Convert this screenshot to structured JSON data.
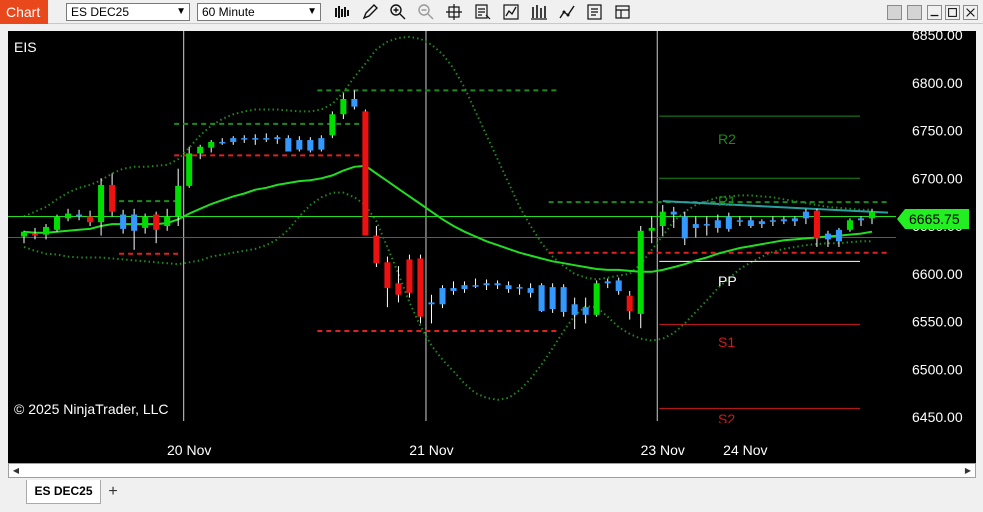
{
  "titlebar": {
    "chart_button": "Chart",
    "instrument": "ES DEC25",
    "interval": "60 Minute"
  },
  "toolbar_icons": [
    "bar-style-icon",
    "pencil-draw-icon",
    "zoom-in-icon",
    "zoom-out-icon",
    "crosshair-icon",
    "data-box-icon",
    "indicators-icon",
    "strategies-icon",
    "drawing-tools-icon",
    "properties-icon"
  ],
  "chart": {
    "symbol_label": "EIS",
    "copyright": "© 2025 NinjaTrader, LLC",
    "current_price": "6665.75",
    "pivot_labels": {
      "r2": "R2",
      "r1": "R1",
      "pp": "PP",
      "s1": "S1",
      "s2": "S2"
    },
    "colors": {
      "up": "#00dd00",
      "down": "#ee1111",
      "neutral_up": "#3399ff",
      "ma": "#22dd22",
      "bands": "#1f8a1f",
      "price_tag": "#22ee22"
    }
  },
  "chart_data": {
    "type": "candlestick",
    "y_axis": {
      "min": 6450,
      "max": 6850,
      "ticks": [
        "6850.00",
        "6800.00",
        "6750.00",
        "6700.00",
        "6650.00",
        "6600.00",
        "6550.00",
        "6500.00",
        "6450.00"
      ]
    },
    "x_ticks": [
      "20 Nov",
      "21 Nov",
      "23 Nov",
      "24 Nov"
    ],
    "candles": [
      {
        "o": 6639,
        "h": 6645,
        "l": 6632,
        "c": 6644,
        "t": "u"
      },
      {
        "o": 6642,
        "h": 6648,
        "l": 6636,
        "c": 6640,
        "t": "d"
      },
      {
        "o": 6641,
        "h": 6652,
        "l": 6636,
        "c": 6649,
        "t": "u"
      },
      {
        "o": 6646,
        "h": 6662,
        "l": 6644,
        "c": 6660,
        "t": "u"
      },
      {
        "o": 6658,
        "h": 6668,
        "l": 6655,
        "c": 6663,
        "t": "u"
      },
      {
        "o": 6662,
        "h": 6667,
        "l": 6656,
        "c": 6660,
        "t": "n"
      },
      {
        "o": 6660,
        "h": 6666,
        "l": 6650,
        "c": 6654,
        "t": "d"
      },
      {
        "o": 6654,
        "h": 6700,
        "l": 6640,
        "c": 6693,
        "t": "u"
      },
      {
        "o": 6693,
        "h": 6705,
        "l": 6660,
        "c": 6665,
        "t": "d"
      },
      {
        "o": 6662,
        "h": 6667,
        "l": 6642,
        "c": 6647,
        "t": "n"
      },
      {
        "o": 6662,
        "h": 6668,
        "l": 6625,
        "c": 6645,
        "t": "n"
      },
      {
        "o": 6648,
        "h": 6663,
        "l": 6642,
        "c": 6660,
        "t": "u"
      },
      {
        "o": 6662,
        "h": 6665,
        "l": 6632,
        "c": 6646,
        "t": "d"
      },
      {
        "o": 6650,
        "h": 6668,
        "l": 6645,
        "c": 6660,
        "t": "u"
      },
      {
        "o": 6660,
        "h": 6710,
        "l": 6650,
        "c": 6692,
        "t": "u"
      },
      {
        "o": 6692,
        "h": 6733,
        "l": 6690,
        "c": 6726,
        "t": "u"
      },
      {
        "o": 6726,
        "h": 6735,
        "l": 6720,
        "c": 6733,
        "t": "u"
      },
      {
        "o": 6732,
        "h": 6740,
        "l": 6727,
        "c": 6738,
        "t": "u"
      },
      {
        "o": 6738,
        "h": 6742,
        "l": 6735,
        "c": 6737,
        "t": "n"
      },
      {
        "o": 6738,
        "h": 6744,
        "l": 6735,
        "c": 6742,
        "t": "n"
      },
      {
        "o": 6742,
        "h": 6745,
        "l": 6737,
        "c": 6741,
        "t": "n"
      },
      {
        "o": 6741,
        "h": 6746,
        "l": 6735,
        "c": 6742,
        "t": "n"
      },
      {
        "o": 6742,
        "h": 6747,
        "l": 6738,
        "c": 6741,
        "t": "n"
      },
      {
        "o": 6741,
        "h": 6745,
        "l": 6736,
        "c": 6743,
        "t": "n"
      },
      {
        "o": 6742,
        "h": 6745,
        "l": 6729,
        "c": 6728,
        "t": "n"
      },
      {
        "o": 6740,
        "h": 6744,
        "l": 6728,
        "c": 6730,
        "t": "n"
      },
      {
        "o": 6740,
        "h": 6743,
        "l": 6727,
        "c": 6729,
        "t": "n"
      },
      {
        "o": 6730,
        "h": 6745,
        "l": 6728,
        "c": 6742,
        "t": "n"
      },
      {
        "o": 6745,
        "h": 6770,
        "l": 6742,
        "c": 6767,
        "t": "u"
      },
      {
        "o": 6767,
        "h": 6789,
        "l": 6762,
        "c": 6783,
        "t": "u"
      },
      {
        "o": 6783,
        "h": 6792,
        "l": 6772,
        "c": 6775,
        "t": "n"
      },
      {
        "o": 6770,
        "h": 6772,
        "l": 6650,
        "c": 6640,
        "t": "d"
      },
      {
        "o": 6640,
        "h": 6650,
        "l": 6607,
        "c": 6611,
        "t": "d"
      },
      {
        "o": 6612,
        "h": 6618,
        "l": 6565,
        "c": 6585,
        "t": "d"
      },
      {
        "o": 6590,
        "h": 6608,
        "l": 6570,
        "c": 6578,
        "t": "d"
      },
      {
        "o": 6580,
        "h": 6620,
        "l": 6575,
        "c": 6615,
        "t": "d"
      },
      {
        "o": 6616,
        "h": 6620,
        "l": 6548,
        "c": 6555,
        "t": "d"
      },
      {
        "o": 6570,
        "h": 6578,
        "l": 6548,
        "c": 6568,
        "t": "n"
      },
      {
        "o": 6568,
        "h": 6588,
        "l": 6564,
        "c": 6585,
        "t": "n"
      },
      {
        "o": 6585,
        "h": 6592,
        "l": 6578,
        "c": 6582,
        "t": "n"
      },
      {
        "o": 6584,
        "h": 6592,
        "l": 6580,
        "c": 6588,
        "t": "n"
      },
      {
        "o": 6588,
        "h": 6595,
        "l": 6585,
        "c": 6588,
        "t": "n"
      },
      {
        "o": 6588,
        "h": 6594,
        "l": 6583,
        "c": 6590,
        "t": "n"
      },
      {
        "o": 6590,
        "h": 6593,
        "l": 6584,
        "c": 6588,
        "t": "n"
      },
      {
        "o": 6588,
        "h": 6592,
        "l": 6580,
        "c": 6584,
        "t": "n"
      },
      {
        "o": 6585,
        "h": 6589,
        "l": 6578,
        "c": 6586,
        "t": "n"
      },
      {
        "o": 6585,
        "h": 6590,
        "l": 6575,
        "c": 6580,
        "t": "n"
      },
      {
        "o": 6588,
        "h": 6590,
        "l": 6560,
        "c": 6561,
        "t": "n"
      },
      {
        "o": 6586,
        "h": 6590,
        "l": 6559,
        "c": 6563,
        "t": "n"
      },
      {
        "o": 6586,
        "h": 6589,
        "l": 6555,
        "c": 6560,
        "t": "n"
      },
      {
        "o": 6568,
        "h": 6575,
        "l": 6542,
        "c": 6557,
        "t": "n"
      },
      {
        "o": 6565,
        "h": 6575,
        "l": 6548,
        "c": 6557,
        "t": "n"
      },
      {
        "o": 6557,
        "h": 6593,
        "l": 6555,
        "c": 6590,
        "t": "u"
      },
      {
        "o": 6590,
        "h": 6595,
        "l": 6585,
        "c": 6592,
        "t": "n"
      },
      {
        "o": 6593,
        "h": 6596,
        "l": 6578,
        "c": 6582,
        "t": "n"
      },
      {
        "o": 6577,
        "h": 6582,
        "l": 6552,
        "c": 6561,
        "t": "d"
      },
      {
        "o": 6558,
        "h": 6650,
        "l": 6543,
        "c": 6645,
        "t": "u"
      },
      {
        "o": 6645,
        "h": 6660,
        "l": 6632,
        "c": 6648,
        "t": "u"
      },
      {
        "o": 6650,
        "h": 6672,
        "l": 6640,
        "c": 6665,
        "t": "u"
      },
      {
        "o": 6665,
        "h": 6670,
        "l": 6648,
        "c": 6662,
        "t": "n"
      },
      {
        "o": 6660,
        "h": 6665,
        "l": 6630,
        "c": 6637,
        "t": "n"
      },
      {
        "o": 6652,
        "h": 6660,
        "l": 6638,
        "c": 6648,
        "t": "n"
      },
      {
        "o": 6652,
        "h": 6660,
        "l": 6640,
        "c": 6652,
        "t": "n"
      },
      {
        "o": 6656,
        "h": 6662,
        "l": 6643,
        "c": 6648,
        "t": "n"
      },
      {
        "o": 6660,
        "h": 6664,
        "l": 6644,
        "c": 6647,
        "t": "n"
      },
      {
        "o": 6655,
        "h": 6660,
        "l": 6650,
        "c": 6656,
        "t": "n"
      },
      {
        "o": 6656,
        "h": 6660,
        "l": 6648,
        "c": 6650,
        "t": "n"
      },
      {
        "o": 6652,
        "h": 6657,
        "l": 6648,
        "c": 6655,
        "t": "n"
      },
      {
        "o": 6655,
        "h": 6660,
        "l": 6650,
        "c": 6656,
        "t": "n"
      },
      {
        "o": 6657,
        "h": 6660,
        "l": 6652,
        "c": 6655,
        "t": "n"
      },
      {
        "o": 6655,
        "h": 6660,
        "l": 6650,
        "c": 6658,
        "t": "n"
      },
      {
        "o": 6658,
        "h": 6668,
        "l": 6652,
        "c": 6665,
        "t": "n"
      },
      {
        "o": 6666,
        "h": 6668,
        "l": 6628,
        "c": 6637,
        "t": "d"
      },
      {
        "o": 6642,
        "h": 6645,
        "l": 6628,
        "c": 6636,
        "t": "n"
      },
      {
        "o": 6634,
        "h": 6648,
        "l": 6628,
        "c": 6646,
        "t": "n"
      },
      {
        "o": 6646,
        "h": 6658,
        "l": 6644,
        "c": 6656,
        "t": "u"
      },
      {
        "o": 6656,
        "h": 6660,
        "l": 6650,
        "c": 6658,
        "t": "n"
      },
      {
        "o": 6658,
        "h": 6668,
        "l": 6652,
        "c": 6665,
        "t": "u"
      }
    ],
    "ma": [
      6644,
      6643,
      6643,
      6644,
      6645,
      6646,
      6647,
      6650,
      6652,
      6652,
      6652,
      6652,
      6652,
      6653,
      6657,
      6663,
      6668,
      6673,
      6677,
      6681,
      6684,
      6688,
      6690,
      6693,
      6695,
      6697,
      6698,
      6700,
      6703,
      6708,
      6712,
      6713,
      6705,
      6697,
      6689,
      6681,
      6673,
      6665,
      6657,
      6650,
      6644,
      6639,
      6634,
      6630,
      6626,
      6622,
      6619,
      6616,
      6613,
      6611,
      6609,
      6607,
      6605,
      6604,
      6604,
      6603,
      6602,
      6602,
      6604,
      6607,
      6610,
      6614,
      6617,
      6621,
      6624,
      6627,
      6629,
      6631,
      6633,
      6635,
      6636,
      6637,
      6638,
      6639,
      6640,
      6641,
      6642,
      6644
    ],
    "upper_band": [
      6660,
      6665,
      6670,
      6678,
      6685,
      6690,
      6693,
      6698,
      6705,
      6710,
      6712,
      6712,
      6713,
      6714,
      6720,
      6732,
      6745,
      6755,
      6762,
      6767,
      6770,
      6772,
      6772,
      6772,
      6771,
      6770,
      6770,
      6772,
      6778,
      6790,
      6806,
      6820,
      6835,
      6843,
      6847,
      6848,
      6846,
      6840,
      6830,
      6815,
      6795,
      6770,
      6745,
      6720,
      6695,
      6670,
      6650,
      6632,
      6618,
      6608,
      6600,
      6596,
      6594,
      6596,
      6598,
      6600,
      6610,
      6625,
      6640,
      6655,
      6665,
      6672,
      6676,
      6680,
      6681,
      6682,
      6682,
      6681,
      6680,
      6678,
      6676,
      6674,
      6672,
      6670,
      6669,
      6668,
      6667,
      6667
    ],
    "lower_band": [
      6628,
      6624,
      6621,
      6620,
      6618,
      6617,
      6617,
      6617,
      6616,
      6615,
      6614,
      6613,
      6612,
      6611,
      6610,
      6612,
      6614,
      6618,
      6620,
      6622,
      6624,
      6626,
      6630,
      6636,
      6646,
      6660,
      6672,
      6680,
      6685,
      6685,
      6680,
      6672,
      6655,
      6628,
      6600,
      6570,
      6545,
      6525,
      6510,
      6498,
      6485,
      6475,
      6470,
      6468,
      6470,
      6478,
      6490,
      6505,
      6522,
      6540,
      6556,
      6566,
      6565,
      6555,
      6544,
      6537,
      6532,
      6530,
      6532,
      6538,
      6548,
      6560,
      6572,
      6585,
      6595,
      6605,
      6612,
      6618,
      6623,
      6626,
      6628,
      6630,
      6631,
      6632,
      6632,
      6633,
      6634,
      6634
    ],
    "levels": [
      {
        "value": 6660,
        "color": "#22dd22",
        "type": "solid"
      },
      {
        "value": 6638,
        "color": "#dd2222",
        "type": "solid"
      }
    ],
    "segments": [
      {
        "x0": 9,
        "x1": 14,
        "value": 6676,
        "color": "#1f8a1f"
      },
      {
        "x0": 9,
        "x1": 14,
        "value": 6621,
        "color": "#dd2222"
      },
      {
        "x0": 14,
        "x1": 31,
        "value": 6757,
        "color": "#1f8a1f"
      },
      {
        "x0": 14,
        "x1": 31,
        "value": 6724,
        "color": "#dd2222"
      },
      {
        "x0": 27,
        "x1": 48,
        "value": 6792,
        "color": "#1f8a1f"
      },
      {
        "x0": 27,
        "x1": 48,
        "value": 6540,
        "color": "#dd2222"
      },
      {
        "x0": 48,
        "x1": 78,
        "value": 6675,
        "color": "#1f8a1f"
      },
      {
        "x0": 48,
        "x1": 78,
        "value": 6622,
        "color": "#dd2222"
      }
    ],
    "pivots": [
      {
        "name": "R2",
        "value": 6765,
        "color": "#1a8a1a"
      },
      {
        "name": "R1",
        "value": 6700,
        "color": "#1a8a1a"
      },
      {
        "name": "PP",
        "value": 6613,
        "color": "#ffffff"
      },
      {
        "name": "S1",
        "value": 6547,
        "color": "#cc1b1b"
      },
      {
        "name": "S2",
        "value": 6459,
        "color": "#cc1b1b"
      }
    ]
  },
  "tabs": {
    "active": "ES DEC25",
    "add": "+"
  }
}
